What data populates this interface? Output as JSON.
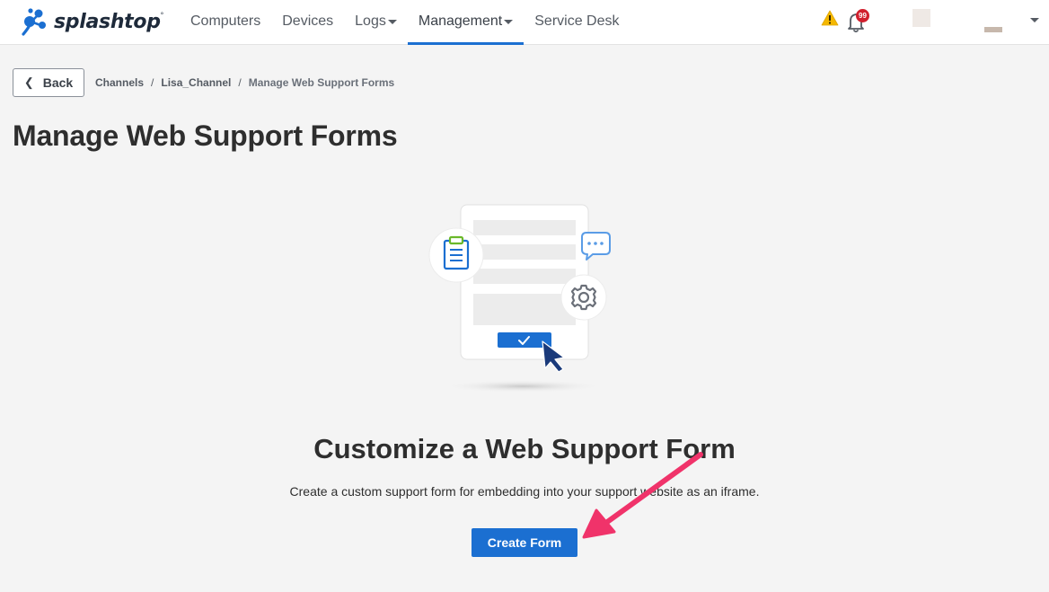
{
  "brand": {
    "name": "splashtop",
    "trademark": "°",
    "color": "#1b6fd1"
  },
  "nav": {
    "items": [
      {
        "label": "Computers",
        "dropdown": false,
        "active": false
      },
      {
        "label": "Devices",
        "dropdown": false,
        "active": false
      },
      {
        "label": "Logs",
        "dropdown": true,
        "active": false
      },
      {
        "label": "Management",
        "dropdown": true,
        "active": true
      },
      {
        "label": "Service Desk",
        "dropdown": false,
        "active": false
      }
    ]
  },
  "header": {
    "notification_count": "99",
    "warning_icon": "warning-icon",
    "bell_icon": "bell-icon"
  },
  "breadcrumb": {
    "back_label": "Back",
    "items": [
      "Channels",
      "Lisa_Channel",
      "Manage Web Support Forms"
    ],
    "separator": "/"
  },
  "page": {
    "title": "Manage Web Support Forms"
  },
  "empty_state": {
    "title": "Customize a Web Support Form",
    "description": "Create a custom support form for embedding into your support website as an iframe.",
    "button_label": "Create Form"
  },
  "colors": {
    "accent": "#1b6fd1",
    "annotation_arrow": "#f0336a",
    "badge": "#d11f2d",
    "warning": "#f5b800"
  }
}
